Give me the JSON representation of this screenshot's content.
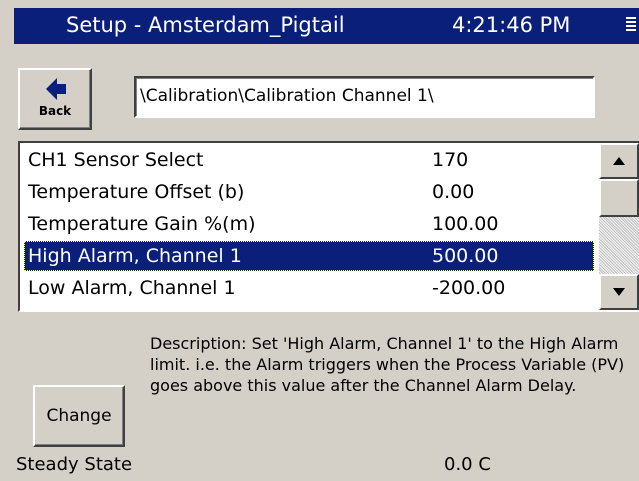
{
  "titlebar": {
    "title": "Setup - Amsterdam_Pigtail",
    "time": "4:21:46 PM",
    "menu_icon": "hamburger-icon",
    "background": "#0a1f7a"
  },
  "back_button": {
    "label": "Back",
    "icon": "left-arrow-icon"
  },
  "path": {
    "value": "\\Calibration\\Calibration Channel 1\\"
  },
  "list": {
    "rows": [
      {
        "name": "CH1 Sensor Select",
        "value": "170",
        "selected": false
      },
      {
        "name": "Temperature Offset (b)",
        "value": "0.00",
        "selected": false
      },
      {
        "name": "Temperature Gain %(m)",
        "value": "100.00",
        "selected": false
      },
      {
        "name": "High Alarm, Channel 1",
        "value": "500.00",
        "selected": true
      },
      {
        "name": "Low Alarm, Channel 1",
        "value": "-200.00",
        "selected": false
      }
    ],
    "selection_color": "#0a1f7a"
  },
  "description": {
    "text": "Description:  Set 'High Alarm, Channel 1' to the High Alarm limit.  i.e. the Alarm triggers when the Process Variable (PV) goes above this value after the Channel Alarm Delay."
  },
  "change_button": {
    "label": "Change"
  },
  "status": {
    "label": "Steady State",
    "value": "0.0 C"
  }
}
